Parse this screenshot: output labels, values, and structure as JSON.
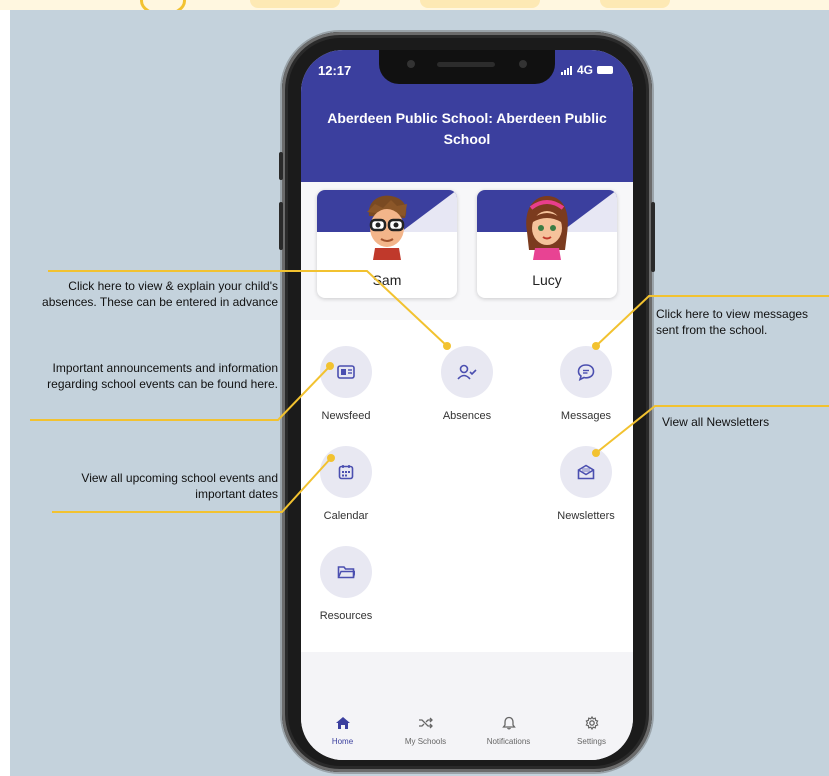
{
  "status_bar": {
    "time": "12:17",
    "network": "4G"
  },
  "header": {
    "school_title": "Aberdeen Public School: Aberdeen Public School"
  },
  "children": [
    {
      "name": "Sam",
      "avatar_icon": "boy-avatar-icon"
    },
    {
      "name": "Lucy",
      "avatar_icon": "girl-avatar-icon"
    }
  ],
  "menu": {
    "newsfeed": "Newsfeed",
    "absences": "Absences",
    "messages": "Messages",
    "calendar": "Calendar",
    "newsletters": "Newsletters",
    "resources": "Resources"
  },
  "tabs": {
    "home": "Home",
    "my_schools": "My Schools",
    "notifications": "Notifications",
    "settings": "Settings"
  },
  "callouts": {
    "absences": "Click here to view & explain your child's absences. These can be entered in advance",
    "newsfeed": "Important announcements and information regarding school events can be found here.",
    "calendar": "View all upcoming school events and important dates",
    "messages": "Click here to view messages sent from the school.",
    "newsletters": "View all Newsletters"
  },
  "colors": {
    "brand": "#3b3f9e",
    "callout_line": "#f2c230",
    "background": "#c4d2dc"
  }
}
